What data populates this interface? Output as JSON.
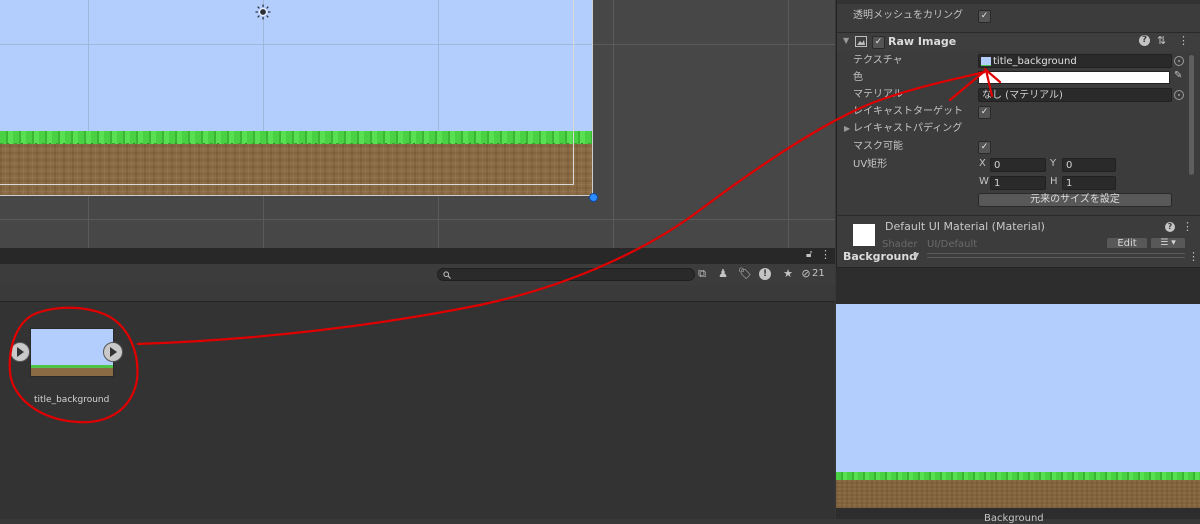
{
  "inspector": {
    "cull_transparent_mesh_label": "透明メッシュをカリング",
    "raw_image": {
      "title": "Raw Image",
      "texture_label": "テクスチャ",
      "texture_value": "title_background",
      "color_label": "色",
      "material_label": "マテリアル",
      "material_value": "なし (マテリアル)",
      "raycast_target_label": "レイキャストターゲット",
      "raycast_padding_label": "レイキャストパディング",
      "maskable_label": "マスク可能",
      "uv_rect_label": "UV矩形",
      "uv": {
        "x_label": "X",
        "x": "0",
        "y_label": "Y",
        "y": "0",
        "w_label": "W",
        "w": "1",
        "h_label": "H",
        "h": "1"
      },
      "set_native_size_button": "元来のサイズを設定"
    },
    "material_section": {
      "title": "Default UI Material (Material)",
      "shader_label": "Shader",
      "shader_value": "UI/Default",
      "edit_button": "Edit"
    }
  },
  "project": {
    "hidden_count": "21",
    "asset": {
      "name": "title_background"
    }
  },
  "preview": {
    "title": "Background",
    "caption": "Background"
  },
  "colors": {
    "sky": "#b3cefd",
    "grass": "#49d043",
    "dirt": "#8b6b44",
    "annotation": "#e00000"
  }
}
